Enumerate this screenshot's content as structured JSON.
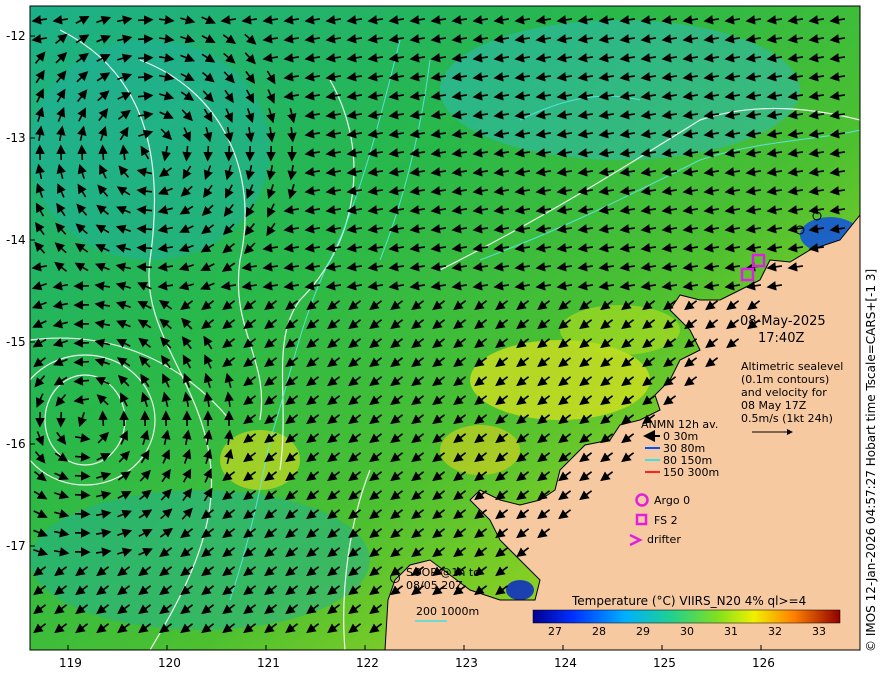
{
  "datetime": {
    "date": "08-May-2025",
    "time": "17:40Z"
  },
  "altimetry": {
    "lines": [
      "Altimetric sealevel",
      "(0.1m contours)",
      "and velocity for",
      "08 May 17Z",
      "0.5m/s (1kt 24h)"
    ]
  },
  "anmn_legend": {
    "title": "ANMN 12h av.",
    "items": [
      {
        "label": "0 30m",
        "color": "#000000"
      },
      {
        "label": "30 80m",
        "color": "#0050ff"
      },
      {
        "label": "80 150m",
        "color": "#40e0e0"
      },
      {
        "label": "150 300m",
        "color": "#ff2020"
      }
    ]
  },
  "markers": {
    "argo": {
      "label": "Argo 0",
      "color": "#e020e0"
    },
    "fs": {
      "label": "FS 2",
      "color": "#e020e0"
    },
    "drifter": {
      "label": "drifter",
      "color": "#e020e0"
    }
  },
  "soop": {
    "lines": [
      "SOOP @1h to",
      "08/05 20Z"
    ]
  },
  "bathy": {
    "label": "200 1000m"
  },
  "colorbar": {
    "title": "Temperature (°C) VIIRS_N20 4% ql>=4",
    "ticks": [
      "27",
      "28",
      "29",
      "30",
      "31",
      "32",
      "33"
    ],
    "range": [
      26.5,
      33.5
    ]
  },
  "axes": {
    "x_ticks": [
      "119",
      "120",
      "121",
      "122",
      "123",
      "124",
      "125",
      "126"
    ],
    "y_ticks": [
      "-12",
      "-13",
      "-14",
      "-15",
      "-16",
      "-17"
    ]
  },
  "credit": "© IMOS 12-Jan-2026 04:57:27 Hobart time Tscale=CARS+[-1 3]",
  "colors": {
    "land": "#f7c9a1",
    "ocean_warm": "#2fbf3a",
    "ocean_cool": "#1aa8d8"
  }
}
